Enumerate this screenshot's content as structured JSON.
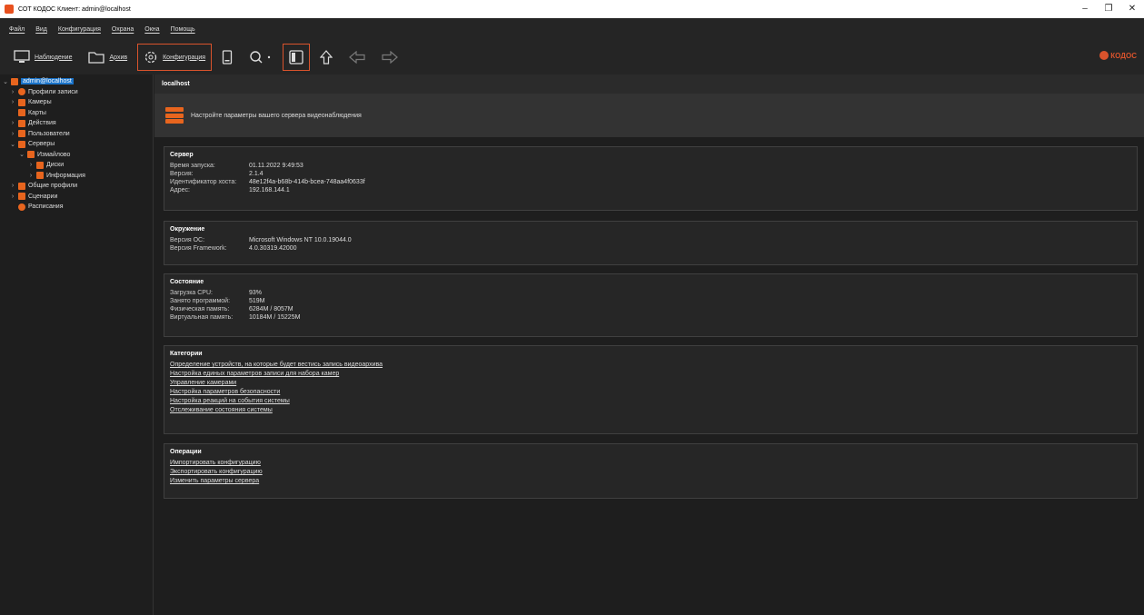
{
  "window": {
    "title": "СОТ КОДОС Клиент: admin@localhost",
    "controls": [
      "–",
      "❐",
      "✕"
    ]
  },
  "menu": [
    "Файл",
    "Вид",
    "Конфигурация",
    "Охрана",
    "Окна",
    "Помощь"
  ],
  "toolbar": {
    "observe": "Наблюдение",
    "archive": "Архив",
    "config": "Конфигурация",
    "brand": "КОДОС"
  },
  "tree": [
    {
      "label": "admin@localhost",
      "selected": true
    },
    {
      "label": "Профили записи"
    },
    {
      "label": "Камеры"
    },
    {
      "label": "Карты"
    },
    {
      "label": "Действия"
    },
    {
      "label": "Пользователи"
    },
    {
      "label": "Серверы"
    },
    {
      "label": "Измайлово"
    },
    {
      "label": "Диски"
    },
    {
      "label": "Информация"
    },
    {
      "label": "Общие профили"
    },
    {
      "label": "Сценарии"
    },
    {
      "label": "Расписания"
    }
  ],
  "main": {
    "header": "localhost",
    "banner": "Настройте параметры вашего сервера видеонаблюдения",
    "server": {
      "title": "Сервер",
      "rows": [
        {
          "k": "Время запуска:",
          "v": "01.11.2022 9:49:53"
        },
        {
          "k": "Версия:",
          "v": "2.1.4"
        },
        {
          "k": "Идентификатор хоста:",
          "v": "48e12f4a-b68b-414b-bcea-748aa4f0633f"
        },
        {
          "k": "Адрес:",
          "v": "192.168.144.1"
        }
      ]
    },
    "env": {
      "title": "Окружение",
      "rows": [
        {
          "k": "Версия ОС:",
          "v": "Microsoft Windows NT 10.0.19044.0"
        },
        {
          "k": "Версия Framework:",
          "v": "4.0.30319.42000"
        }
      ]
    },
    "state": {
      "title": "Состояние",
      "rows": [
        {
          "k": "Загрузка CPU:",
          "v": "93%"
        },
        {
          "k": "Занято программой:",
          "v": "519M"
        },
        {
          "k": "Физическая память:",
          "v": "6284M / 8057M"
        },
        {
          "k": "Виртуальная память:",
          "v": "10184M / 15225M"
        }
      ]
    },
    "categories": {
      "title": "Категории",
      "links": [
        "Определение устройств, на которые будет вестись запись видеоархива",
        "Настройка единых параметров записи для набора камер",
        "Управление камерами",
        "Настройка параметров безопасности",
        "Настройка реакций на события системы",
        "Отслеживание состояния системы"
      ]
    },
    "ops": {
      "title": "Операции",
      "links": [
        "Импортировать конфигурацию",
        "Экспортировать конфигурацию",
        "Изменить параметры сервера"
      ]
    }
  }
}
